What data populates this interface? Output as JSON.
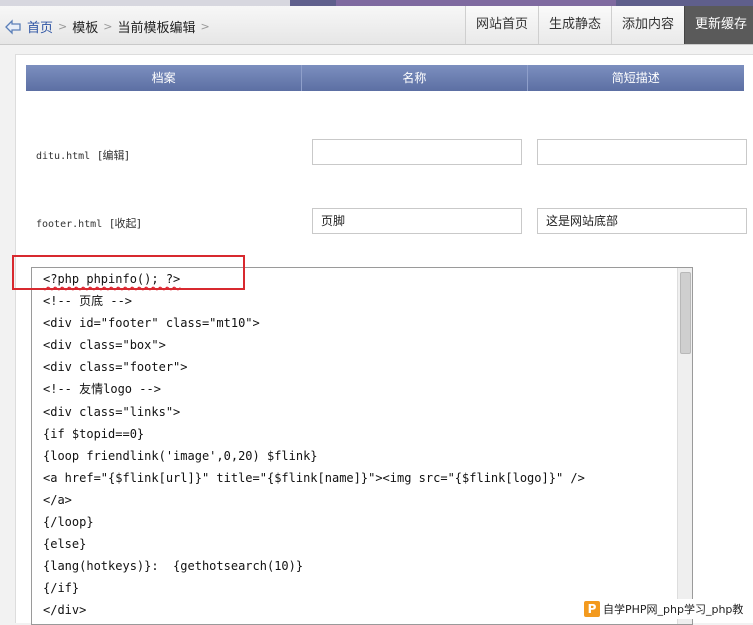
{
  "breadcrumb": {
    "home": "首页",
    "template": "模板",
    "current": "当前模板编辑",
    "separator": ">"
  },
  "nav_buttons": {
    "site_home": "网站首页",
    "generate_static": "生成静态",
    "add_content": "添加内容",
    "update_cache": "更新缓存"
  },
  "table": {
    "headers": {
      "file": "档案",
      "name": "名称",
      "description": "简短描述"
    },
    "rows": [
      {
        "file": "ditu.html",
        "action": "[编辑]",
        "name": "",
        "description": ""
      },
      {
        "file": "footer.html",
        "action": "[收起]",
        "name": "页脚",
        "description": "这是网站底部"
      }
    ]
  },
  "editor": {
    "lines": [
      "<?php phpinfo(); ?>",
      "<!-- 页底 -->",
      "<div id=\"footer\" class=\"mt10\">",
      "<div class=\"box\">",
      "<div class=\"footer\">",
      "<!-- 友情logo -->",
      "<div class=\"links\">",
      "{if $topid==0}",
      "{loop friendlink('image',0,20) $flink}",
      "<a href=\"{$flink[url]}\" title=\"{$flink[name]}\"><img src=\"{$flink[logo]}\" />",
      "</a>",
      "{/loop}",
      "{else}",
      "{lang(hotkeys)}:  {gethotsearch(10)}",
      "{/if}",
      "</div>"
    ]
  },
  "watermark": {
    "logo_letter": "P",
    "text": "自学PHP网_php学习_php教"
  },
  "colors": {
    "header_bar": "#6b7fb3",
    "highlight_box": "#d8292f",
    "link": "#2f55a4"
  },
  "icons": {
    "home": "home-arrow-icon"
  }
}
